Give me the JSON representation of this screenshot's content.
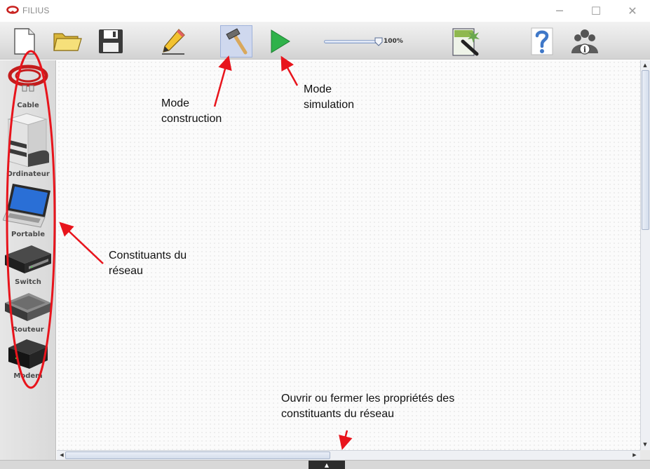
{
  "window": {
    "title": "FILIUS",
    "minimize_glyph": "─",
    "maximize_glyph": "☐",
    "close_glyph": "✕"
  },
  "toolbar": {
    "buttons": [
      {
        "name": "new-file-button",
        "icon": "new-document-icon"
      },
      {
        "name": "open-file-button",
        "icon": "folder-icon"
      },
      {
        "name": "save-button",
        "icon": "floppy-disk-icon"
      },
      {
        "name": "documentation-mode-button",
        "icon": "pencil-icon"
      },
      {
        "name": "design-mode-button",
        "icon": "hammer-icon",
        "active": true
      },
      {
        "name": "simulation-mode-button",
        "icon": "play-icon"
      },
      {
        "name": "software-wizard-button",
        "icon": "wizard-icon"
      },
      {
        "name": "help-button",
        "icon": "question-mark-icon"
      },
      {
        "name": "about-button",
        "icon": "info-people-icon"
      }
    ],
    "zoom": {
      "label": "100%",
      "value_percent": 100
    }
  },
  "palette": {
    "items": [
      {
        "label": "Cable",
        "icon": "cable-icon"
      },
      {
        "label": "Ordinateur",
        "icon": "computer-tower-icon"
      },
      {
        "label": "Portable",
        "icon": "laptop-icon"
      },
      {
        "label": "Switch",
        "icon": "switch-icon"
      },
      {
        "label": "Routeur",
        "icon": "router-icon"
      },
      {
        "label": "Modem",
        "icon": "modem-icon"
      }
    ]
  },
  "annotations": {
    "mode_construction": [
      "Mode",
      "construction"
    ],
    "mode_simulation": [
      "Mode",
      "simulation"
    ],
    "constituants": [
      "Constituants du",
      "réseau"
    ],
    "proprietes": [
      "Ouvrir ou fermer les propriétés des",
      "constituants du réseau"
    ]
  },
  "colors": {
    "annotation_red": "#e8141c",
    "simulation_green": "#2fb24a",
    "active_button_bg": "#cfd8ee"
  },
  "bottom_toggle_glyph": "▲"
}
